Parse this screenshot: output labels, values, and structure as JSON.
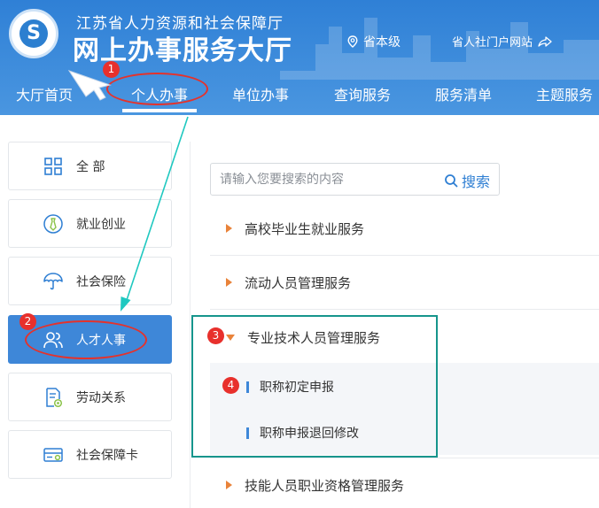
{
  "header": {
    "org_name": "江苏省人力资源和社会保障厅",
    "site_name": "网上办事服务大厅",
    "region": "省本级",
    "portal_link": "省人社门户网站",
    "brand_color": "#2f80d6"
  },
  "nav": {
    "items": [
      "大厅首页",
      "个人办事",
      "单位办事",
      "查询服务",
      "服务清单",
      "主题服务"
    ],
    "active": "个人办事"
  },
  "sidebar": {
    "items": [
      {
        "label": "全 部",
        "icon": "grid-icon"
      },
      {
        "label": "就业创业",
        "icon": "tie-icon"
      },
      {
        "label": "社会保险",
        "icon": "umbrella-icon"
      },
      {
        "label": "人才人事",
        "icon": "users-icon"
      },
      {
        "label": "劳动关系",
        "icon": "document-icon"
      },
      {
        "label": "社会保障卡",
        "icon": "card-icon"
      }
    ],
    "active": "人才人事",
    "active_color": "#3e87d8"
  },
  "search": {
    "placeholder": "请输入您要搜索的内容",
    "button_label": "搜索"
  },
  "categories": [
    {
      "label": "高校毕业生就业服务",
      "expanded": false
    },
    {
      "label": "流动人员管理服务",
      "expanded": false
    },
    {
      "label": "专业技术人员管理服务",
      "expanded": true,
      "subitems": [
        "职称初定申报",
        "职称申报退回修改"
      ]
    },
    {
      "label": "技能人员职业资格管理服务",
      "expanded": false
    }
  ],
  "annotations": {
    "badges": [
      "1",
      "2",
      "3",
      "4"
    ],
    "badge_color": "#e8302c",
    "highlight_color": "#16958c",
    "arrow_color": "#1fc8c0"
  }
}
